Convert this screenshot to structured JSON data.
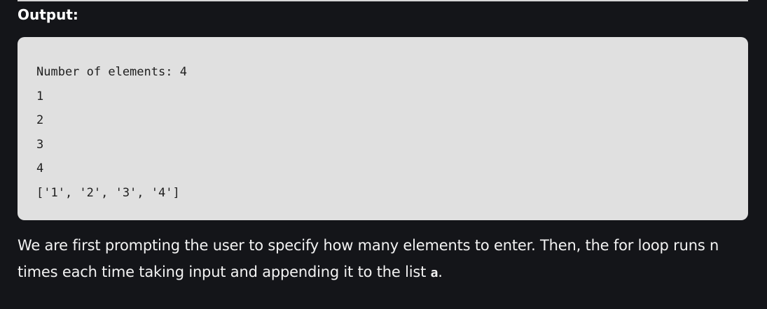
{
  "section": {
    "heading": "Output:"
  },
  "output": {
    "lines": [
      "Number of elements: 4",
      "1",
      "2",
      "3",
      "4",
      "['1', '2', '3', '4']"
    ]
  },
  "explanation": {
    "text_before_code": "We are first prompting the user to specify how many elements to enter. Then, the for loop runs n times each time taking input and appending it to the list ",
    "code_term": "a",
    "text_after_code": "."
  }
}
